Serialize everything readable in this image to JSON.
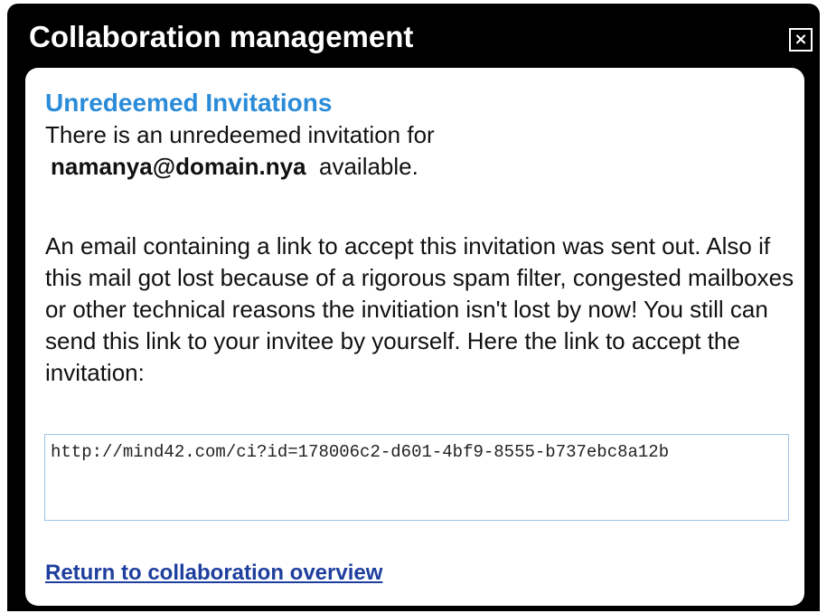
{
  "dialog": {
    "title": "Collaboration management",
    "close_label": "×",
    "close_icon": "close-icon"
  },
  "content": {
    "heading": "Unredeemed Invitations",
    "intro_prefix": "There is an unredeemed invitation for",
    "email": "namanya@domain.nya",
    "intro_suffix": "available.",
    "description": "An email containing a link to accept this invitation was sent out. Also if this mail got lost because of a rigorous spam filter, congested mailboxes or other technical reasons the invitiation isn't lost by now! You still can send this link to your invitee by yourself. Here the link to accept the invitation:",
    "invitation_link": "http://mind42.com/ci?id=178006c2-d601-4bf9-8555-b737ebc8a12b",
    "return_link": "Return to collaboration overview"
  },
  "colors": {
    "titlebar_bg": "#000000",
    "heading": "#2a8bd8",
    "link": "#1e3f9e",
    "field_border": "#9fc3e6"
  }
}
